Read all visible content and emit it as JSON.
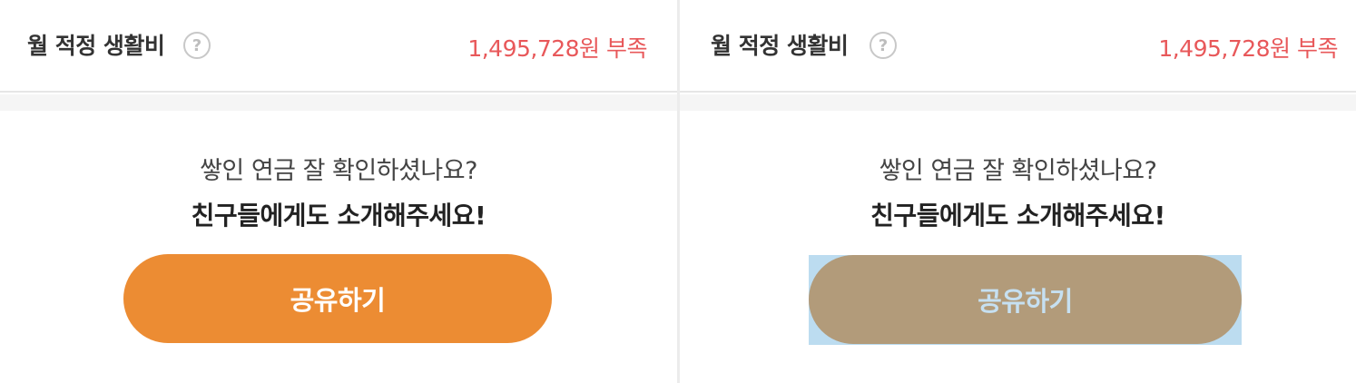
{
  "left_panel": {
    "row": {
      "label": "월 적정 생활비",
      "help_icon": "question-circle-icon",
      "help_glyph": "?",
      "value": "1,495,728원 부족"
    },
    "prompt": {
      "line1": "쌓인 연금 잘 확인하셨나요?",
      "line2": "친구들에게도 소개해주세요!"
    },
    "share_button": {
      "label": "공유하기",
      "color": "#ec8c33"
    }
  },
  "right_panel": {
    "row": {
      "label": "월 적정 생활비",
      "help_icon": "question-circle-icon",
      "help_glyph": "?",
      "value": "1,495,728원 부족"
    },
    "prompt": {
      "line1": "쌓인 연금 잘 확인하셨나요?",
      "line2": "친구들에게도 소개해주세요!"
    },
    "share_button": {
      "label": "공유하기",
      "state": "selected",
      "color": "#b29b7a"
    }
  },
  "colors": {
    "accent": "#ec8c33",
    "shortfall": "#e8585a",
    "selection": "#bcdcf0"
  }
}
